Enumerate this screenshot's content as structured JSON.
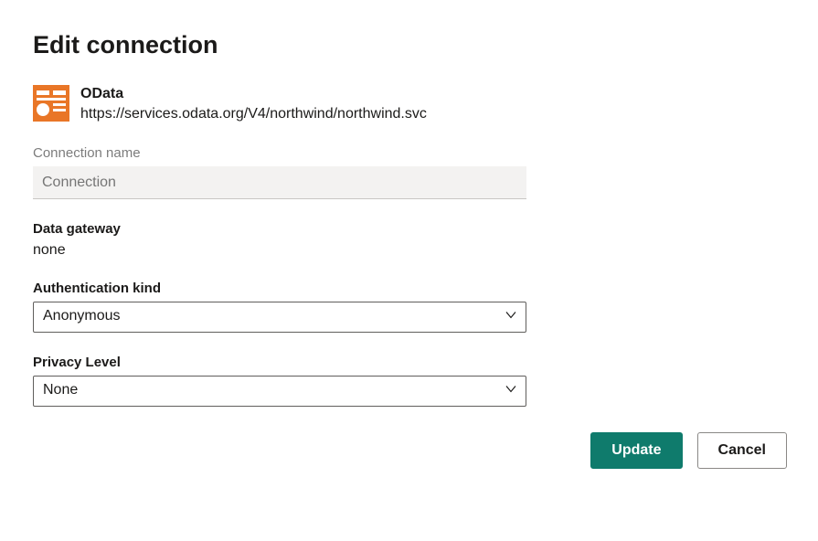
{
  "title": "Edit connection",
  "connector": {
    "icon": "odata-icon",
    "name": "OData",
    "url": "https://services.odata.org/V4/northwind/northwind.svc"
  },
  "fields": {
    "connection_name": {
      "label": "Connection name",
      "placeholder": "Connection",
      "value": ""
    },
    "data_gateway": {
      "label": "Data gateway",
      "value": "none"
    },
    "authentication_kind": {
      "label": "Authentication kind",
      "selected": "Anonymous"
    },
    "privacy_level": {
      "label": "Privacy Level",
      "selected": "None"
    }
  },
  "buttons": {
    "primary": "Update",
    "secondary": "Cancel"
  }
}
